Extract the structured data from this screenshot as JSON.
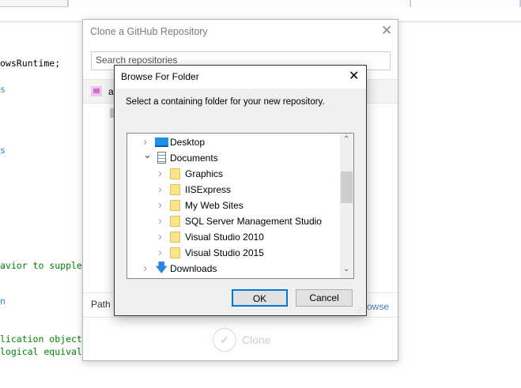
{
  "editor": {
    "lines": [
      "owsRuntime;",
      "s",
      "s",
      "avior to supplem",
      "n",
      "lication object.",
      "logical equivale"
    ]
  },
  "clone_dialog": {
    "title": "Clone a GitHub Repository",
    "search_placeholder": "Search repositories",
    "repo_item": "a",
    "path_label": "Path",
    "browse_link": "rowse",
    "clone_label": "Clone"
  },
  "browse_dialog": {
    "title": "Browse For Folder",
    "instruction": "Select a containing folder for your new repository.",
    "tree": [
      {
        "label": "Desktop",
        "icon": "desktop-icon",
        "level": 1,
        "expanded": false
      },
      {
        "label": "Documents",
        "icon": "documents-icon",
        "level": 1,
        "expanded": true
      },
      {
        "label": "Graphics",
        "icon": "folder-icon",
        "level": 2,
        "expanded": false
      },
      {
        "label": "IISExpress",
        "icon": "folder-icon",
        "level": 2,
        "expanded": false
      },
      {
        "label": "My Web Sites",
        "icon": "folder-icon",
        "level": 2,
        "expanded": false
      },
      {
        "label": "SQL Server Management Studio",
        "icon": "folder-icon",
        "level": 2,
        "expanded": false
      },
      {
        "label": "Visual Studio 2010",
        "icon": "folder-icon",
        "level": 2,
        "expanded": false
      },
      {
        "label": "Visual Studio 2015",
        "icon": "folder-icon",
        "level": 2,
        "expanded": false
      },
      {
        "label": "Downloads",
        "icon": "downloads-icon",
        "level": 1,
        "expanded": false
      }
    ],
    "ok_label": "OK",
    "cancel_label": "Cancel"
  }
}
